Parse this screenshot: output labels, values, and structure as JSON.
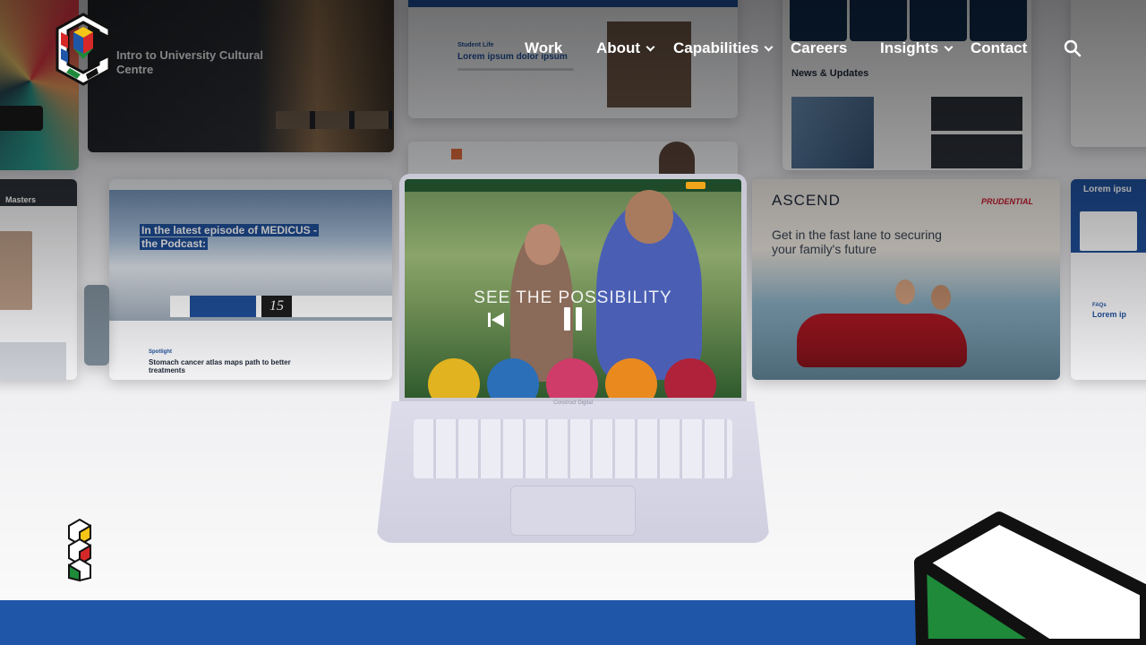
{
  "brand": {
    "name": "Construct Digital",
    "logo_icon": "construct-c-cube-logo"
  },
  "nav": {
    "items": [
      {
        "label": "Work",
        "has_dropdown": false
      },
      {
        "label": "About",
        "has_dropdown": true
      },
      {
        "label": "Capabilities",
        "has_dropdown": true
      },
      {
        "label": "Careers",
        "has_dropdown": false
      },
      {
        "label": "Insights",
        "has_dropdown": true
      },
      {
        "label": "Contact",
        "has_dropdown": false
      }
    ],
    "search_icon": "search-icon"
  },
  "collage": {
    "card_university": {
      "title": "Intro to University Cultural Centre"
    },
    "card_masters": {
      "title": "Masters"
    },
    "card_student": {
      "tag": "Student Life",
      "heading": "Lorem ipsum dolor ipsum"
    },
    "card_news": {
      "title": "News & Updates"
    },
    "card_medicus": {
      "title_line1": "In the latest episode of MEDICUS -",
      "title_line2": "the Podcast:",
      "number": "15",
      "tag": "Spotlight",
      "headline": "Stomach cancer atlas maps path to better treatments"
    },
    "card_ascend": {
      "brand": "ASCEND",
      "partner": "PRUDENTIAL",
      "headline": "Get in the fast lane to securing your family's future"
    },
    "card_right": {
      "title": "Lorem ipsu",
      "faq_label": "FAQs",
      "faq_text": "Lorem ip"
    }
  },
  "video": {
    "title": "SEE THE POSSIBILITY",
    "laptop_brand": "Construct Digital",
    "controls": {
      "prev_icon": "skip-previous-icon",
      "pause_icon": "pause-icon"
    }
  },
  "colors": {
    "accent_blue": "#1f56a8",
    "green": "#1e8a3a",
    "yellow": "#f5c518",
    "red": "#d62828"
  }
}
